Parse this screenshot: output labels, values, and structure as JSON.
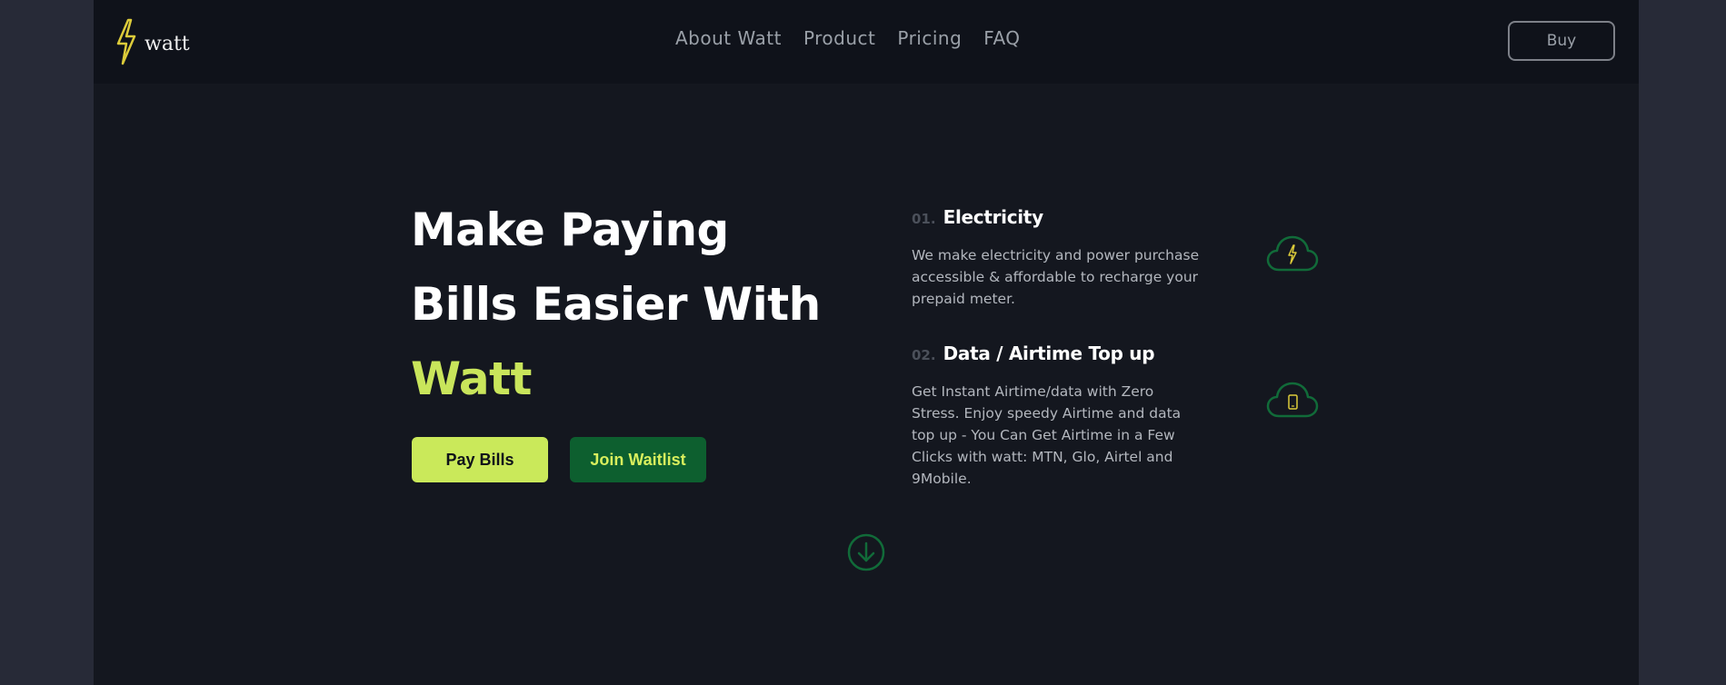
{
  "brand": {
    "name": "watt",
    "accent_color": "#c9e55b",
    "logo_icon": "lightning-bolt-icon"
  },
  "nav": {
    "items": [
      "About Watt",
      "Product",
      "Pricing",
      "FAQ"
    ]
  },
  "header": {
    "buy_label": "Buy"
  },
  "hero": {
    "title_line1": "Make Paying",
    "title_line2": "Bills Easier With",
    "title_line3": "Watt",
    "primary_button": "Pay Bills",
    "secondary_button": "Join Waitlist"
  },
  "features": [
    {
      "number": "01.",
      "title": "Electricity",
      "description": "We make electricity and power purchase accessible & affordable to recharge your prepaid meter.",
      "icon": "cloud-lightning-icon"
    },
    {
      "number": "02.",
      "title": "Data / Airtime Top up",
      "description": "Get Instant Airtime/data with Zero Stress. Enjoy speedy Airtime and data top up - You Can Get Airtime in a Few Clicks with watt: MTN, Glo, Airtel and 9Mobile.",
      "icon": "cloud-phone-icon"
    }
  ],
  "scroll": {
    "icon": "arrow-down-circle-icon"
  },
  "colors": {
    "background": "#14171f",
    "header": "#0f121a",
    "accent": "#c9e55b",
    "green": "#0d5f2f",
    "icon_green": "#116b39"
  }
}
